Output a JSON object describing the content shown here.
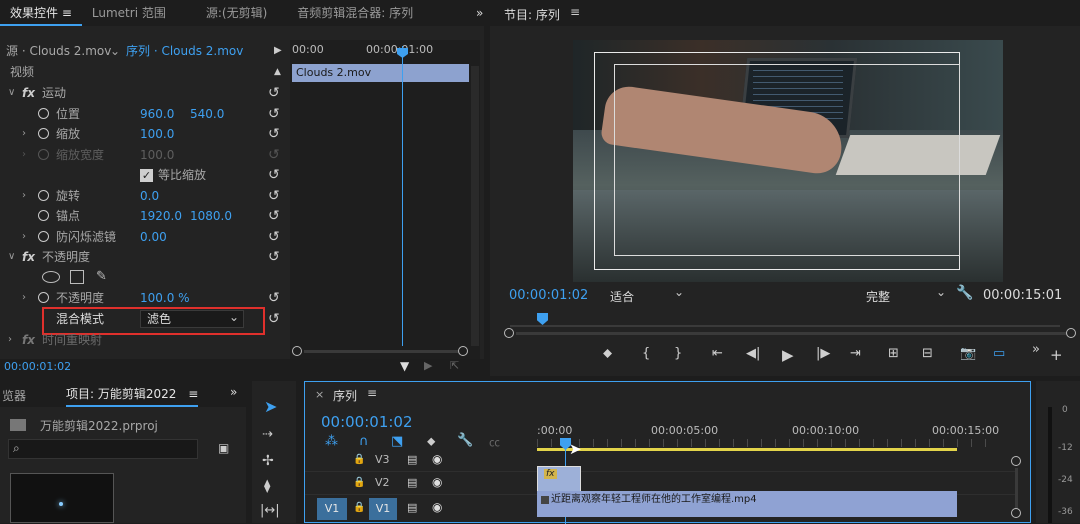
{
  "effect_controls": {
    "tabs": [
      "效果控件",
      "Lumetri 范围",
      "源:(无剪辑)",
      "音频剪辑混合器: 序列"
    ],
    "source_label": "源 · Clouds 2.mov",
    "sequence_label": "序列 · Clouds 2.mov",
    "timecode_left": "00:00",
    "timecode_mid": "00:00:01:00",
    "clip_name": "Clouds 2.mov",
    "section_video": "视频",
    "motion": {
      "label": "运动",
      "position_label": "位置",
      "position_x": "960.0",
      "position_y": "540.0",
      "scale_label": "缩放",
      "scale_value": "100.0",
      "scale_width_label": "缩放宽度",
      "scale_width_value": "100.0",
      "uniform_scale_label": "等比缩放",
      "rotation_label": "旋转",
      "rotation_value": "0.0",
      "anchor_label": "锚点",
      "anchor_x": "1920.0",
      "anchor_y": "1080.0",
      "antiflicker_label": "防闪烁滤镜",
      "antiflicker_value": "0.00"
    },
    "opacity": {
      "label": "不透明度",
      "opacity_label": "不透明度",
      "opacity_value": "100.0 %",
      "blend_label": "混合模式",
      "blend_value": "滤色"
    },
    "time_remap_label": "时间重映射",
    "footer_timecode": "00:00:01:02"
  },
  "program": {
    "title": "节目: 序列",
    "timecode": "00:00:01:02",
    "fit": "适合",
    "quality": "完整",
    "duration": "00:00:15:01"
  },
  "project": {
    "tab_browser": "览器",
    "tab_project": "项目: 万能剪辑2022",
    "file": "万能剪辑2022.prproj"
  },
  "timeline": {
    "title": "序列",
    "timecode": "00:00:01:02",
    "ruler": [
      ":00:00",
      "00:00:05:00",
      "00:00:10:00",
      "00:00:15:00"
    ],
    "tracks": [
      "V3",
      "V2",
      "V1"
    ],
    "v1_source": "V1",
    "clip_v1": "近距离观察年轻工程师在他的工作室编程.mp4",
    "clip_v2": "fx",
    "meter": [
      "0",
      "-12",
      "-24",
      "-36"
    ]
  }
}
